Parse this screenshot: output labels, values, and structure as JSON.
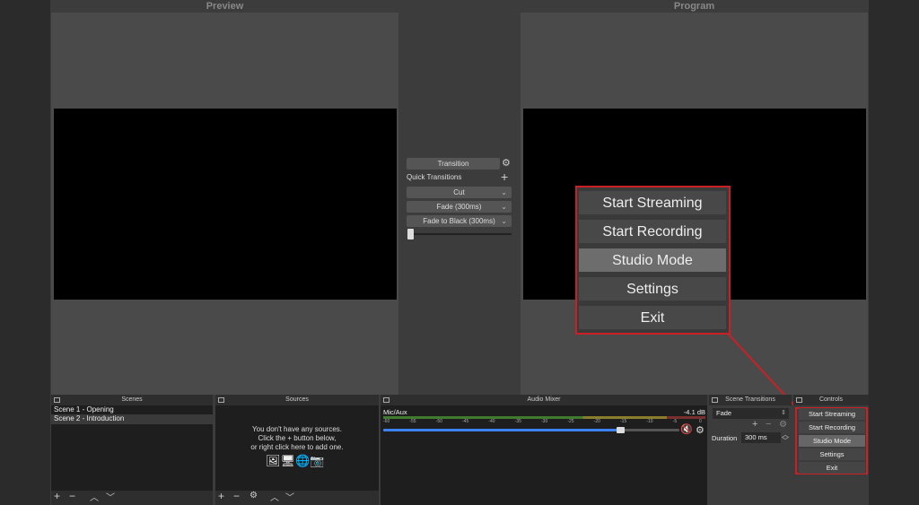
{
  "preview": {
    "title": "Preview"
  },
  "program": {
    "title": "Program"
  },
  "transition": {
    "label": "Transition",
    "quick_label": "Quick Transitions",
    "items": [
      "Cut",
      "Fade (300ms)",
      "Fade to Black (300ms)"
    ]
  },
  "zoom_menu": {
    "items": [
      "Start Streaming",
      "Start Recording",
      "Studio Mode",
      "Settings",
      "Exit"
    ]
  },
  "scenes": {
    "title": "Scenes",
    "items": [
      "Scene 1 - Opening",
      "Scene 2 - Introduction"
    ]
  },
  "sources": {
    "title": "Sources",
    "empty_lines": [
      "You don't have any sources.",
      "Click the + button below,",
      "or right click here to add one."
    ]
  },
  "mixer": {
    "title": "Audio Mixer",
    "channel": "Mic/Aux",
    "level": "-4.1 dB",
    "ticks": [
      "-60",
      "-55",
      "-50",
      "-45",
      "-40",
      "-35",
      "-30",
      "-25",
      "-20",
      "-15",
      "-10",
      "-5",
      "0"
    ]
  },
  "scene_transitions": {
    "title": "Scene Transitions",
    "selected": "Fade",
    "duration_label": "Duration",
    "duration_value": "300 ms"
  },
  "controls": {
    "title": "Controls",
    "items": [
      "Start Streaming",
      "Start Recording",
      "Studio Mode",
      "Settings",
      "Exit"
    ]
  },
  "colors": {
    "highlight": "#cc1f25",
    "accent_blue": "#3b82f6",
    "mute_red": "#d9342b"
  }
}
